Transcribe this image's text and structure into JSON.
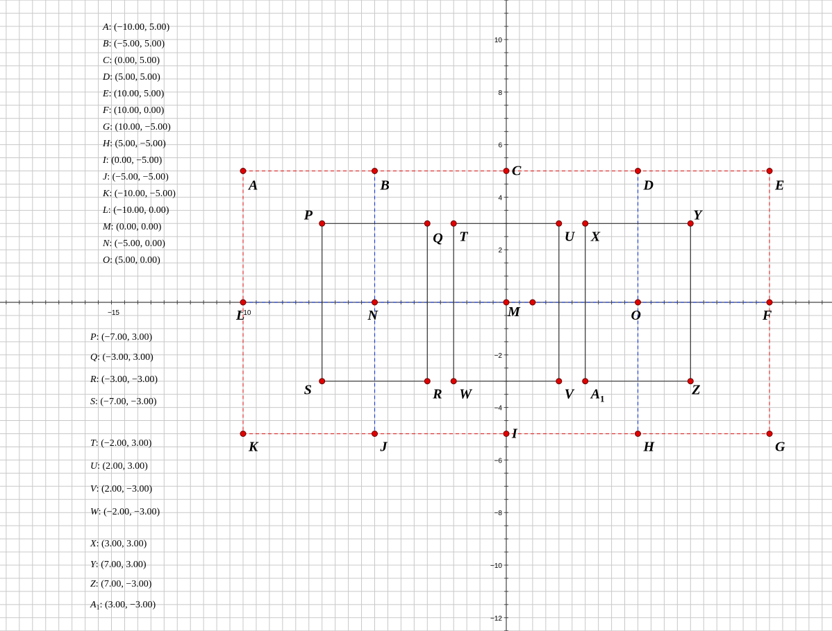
{
  "coords_panel_1": [
    {
      "name": "A",
      "value": "(−10.00, 5.00)"
    },
    {
      "name": "B",
      "value": "(−5.00, 5.00)"
    },
    {
      "name": "C",
      "value": "(0.00, 5.00)"
    },
    {
      "name": "D",
      "value": "(5.00, 5.00)"
    },
    {
      "name": "E",
      "value": "(10.00, 5.00)"
    },
    {
      "name": "F",
      "value": "(10.00, 0.00)"
    },
    {
      "name": "G",
      "value": "(10.00, −5.00)"
    },
    {
      "name": "H",
      "value": "(5.00, −5.00)"
    },
    {
      "name": "I",
      "value": "(0.00, −5.00)"
    },
    {
      "name": "J",
      "value": "(−5.00, −5.00)"
    },
    {
      "name": "K",
      "value": "(−10.00, −5.00)"
    },
    {
      "name": "L",
      "value": "(−10.00, 0.00)"
    },
    {
      "name": "M",
      "value": "(0.00, 0.00)"
    },
    {
      "name": "N",
      "value": "(−5.00, 0.00)"
    },
    {
      "name": "O",
      "value": "(5.00, 0.00)"
    }
  ],
  "coords_panel_2": [
    {
      "name": "P",
      "value": "(−7.00, 3.00)"
    },
    {
      "name": "Q",
      "value": "(−3.00, 3.00)"
    },
    {
      "name": "R",
      "value": "(−3.00, −3.00)"
    },
    {
      "name": "S",
      "value": "(−7.00, −3.00)"
    }
  ],
  "coords_panel_3": [
    {
      "name": "T",
      "value": "(−2.00, 3.00)"
    },
    {
      "name": "U",
      "value": "(2.00, 3.00)"
    },
    {
      "name": "V",
      "value": "(2.00, −3.00)"
    },
    {
      "name": "W",
      "value": "(−2.00, −3.00)"
    }
  ],
  "coords_panel_4": [
    {
      "name": "X",
      "value": "(3.00, 3.00)"
    },
    {
      "name": "Y",
      "value": "(7.00, 3.00)"
    },
    {
      "name": "Z",
      "value": "(7.00, −3.00)"
    },
    {
      "name": "A",
      "sub": "1",
      "value": "(3.00, −3.00)"
    }
  ],
  "axes": {
    "x_ticks": [
      {
        "v": -15,
        "label": "−15"
      },
      {
        "v": -10,
        "label": "−10"
      }
    ],
    "y_ticks": [
      {
        "v": 10,
        "label": "10"
      },
      {
        "v": 8,
        "label": "8"
      },
      {
        "v": 6,
        "label": "6"
      },
      {
        "v": 4,
        "label": "4"
      },
      {
        "v": 2,
        "label": "2"
      },
      {
        "v": -2,
        "label": "−2"
      },
      {
        "v": -4,
        "label": "−4"
      },
      {
        "v": -6,
        "label": "−6"
      },
      {
        "v": -8,
        "label": "−8"
      },
      {
        "v": -10,
        "label": "−10"
      },
      {
        "v": -12,
        "label": "−12"
      }
    ]
  },
  "points": [
    {
      "name": "A",
      "x": -10,
      "y": 5
    },
    {
      "name": "B",
      "x": -5,
      "y": 5
    },
    {
      "name": "C",
      "x": 0,
      "y": 5
    },
    {
      "name": "D",
      "x": 5,
      "y": 5
    },
    {
      "name": "E",
      "x": 10,
      "y": 5
    },
    {
      "name": "F",
      "x": 10,
      "y": 0
    },
    {
      "name": "G",
      "x": 10,
      "y": -5
    },
    {
      "name": "H",
      "x": 5,
      "y": -5
    },
    {
      "name": "I",
      "x": 0,
      "y": -5
    },
    {
      "name": "J",
      "x": -5,
      "y": -5
    },
    {
      "name": "K",
      "x": -10,
      "y": -5
    },
    {
      "name": "L",
      "x": -10,
      "y": 0
    },
    {
      "name": "M",
      "x": 0,
      "y": 0
    },
    {
      "name": "N",
      "x": -5,
      "y": 0
    },
    {
      "name": "O",
      "x": 5,
      "y": 0
    },
    {
      "name": "P",
      "x": -7,
      "y": 3
    },
    {
      "name": "Q",
      "x": -3,
      "y": 3
    },
    {
      "name": "R",
      "x": -3,
      "y": -3
    },
    {
      "name": "S",
      "x": -7,
      "y": -3
    },
    {
      "name": "T",
      "x": -2,
      "y": 3
    },
    {
      "name": "U",
      "x": 2,
      "y": 3
    },
    {
      "name": "V",
      "x": 2,
      "y": -3
    },
    {
      "name": "W",
      "x": -2,
      "y": -3
    },
    {
      "name": "X",
      "x": 3,
      "y": 3
    },
    {
      "name": "Y",
      "x": 7,
      "y": 3
    },
    {
      "name": "Z",
      "x": 7,
      "y": -3
    },
    {
      "name": "A",
      "sub": "1",
      "x": 3,
      "y": -3
    },
    {
      "name": "",
      "x": 1,
      "y": 0
    }
  ],
  "colors": {
    "red_dashed": "#e03030",
    "blue_dashed": "#2040d0",
    "black": "#333333",
    "point_fill": "#e00000",
    "grid": "#c8c8c8"
  }
}
